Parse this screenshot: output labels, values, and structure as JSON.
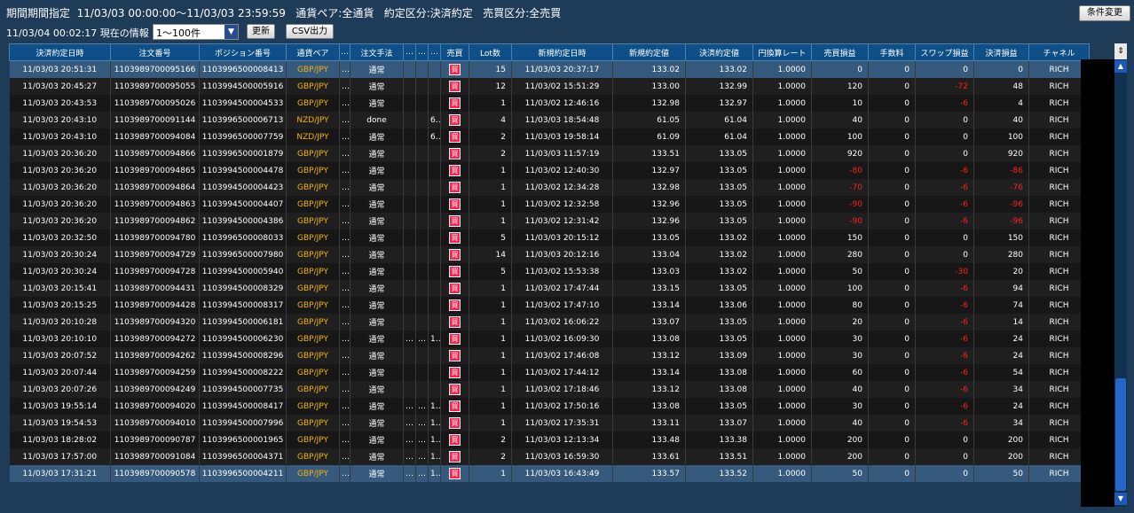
{
  "header": {
    "line1": "期間期間指定  11/03/03 00:00:00〜11/03/03 23:59:59   通貨ペア:全通貨   約定区分:決済約定   売買区分:全売買",
    "condition_button": "条件変更",
    "timestamp_info": "11/03/04 00:02:17 現在の情報",
    "range_select": "1〜100件",
    "refresh_button": "更新",
    "csv_button": "CSV出力"
  },
  "columns": [
    "決済約定日時",
    "注文番号",
    "ポジション番号",
    "通貨ペア",
    "…",
    "注文手法",
    "…",
    "…",
    "…",
    "売買",
    "Lot数",
    "新規約定日時",
    "新規約定値",
    "決済約定値",
    "円換算レート",
    "売買損益",
    "手数料",
    "スワップ損益",
    "決済損益",
    "チャネル"
  ],
  "colors": {
    "header_bg": "#0d4f86",
    "gold_pair": "#f4b400",
    "negative": "#ff2020",
    "buy_badge": "#ff1f4b"
  },
  "rows": [
    {
      "settle": "11/03/03 20:51:31",
      "order": "1103989700095166",
      "pos": "1103996500008413",
      "pair": "GBP/JPY",
      "e1": "…",
      "method": "通常",
      "e2": "",
      "e3": "",
      "e4": "",
      "side": "買",
      "lot": "15",
      "new_dt": "11/03/03 20:37:17",
      "new_px": "133.02",
      "set_px": "133.02",
      "rate": "1.0000",
      "pl": "0",
      "fee": "0",
      "swap": "0",
      "net": "0",
      "ch": "RICH",
      "sel": true
    },
    {
      "settle": "11/03/03 20:45:27",
      "order": "1103989700095055",
      "pos": "1103994500005916",
      "pair": "GBP/JPY",
      "e1": "…",
      "method": "通常",
      "e2": "",
      "e3": "",
      "e4": "",
      "side": "買",
      "lot": "12",
      "new_dt": "11/03/02 15:51:29",
      "new_px": "133.00",
      "set_px": "132.99",
      "rate": "1.0000",
      "pl": "120",
      "fee": "0",
      "swap": "-72",
      "net": "48",
      "ch": "RICH"
    },
    {
      "settle": "11/03/03 20:43:53",
      "order": "1103989700095026",
      "pos": "1103994500004533",
      "pair": "GBP/JPY",
      "e1": "…",
      "method": "通常",
      "e2": "",
      "e3": "",
      "e4": "",
      "side": "買",
      "lot": "1",
      "new_dt": "11/03/02 12:46:16",
      "new_px": "132.98",
      "set_px": "132.97",
      "rate": "1.0000",
      "pl": "10",
      "fee": "0",
      "swap": "-6",
      "net": "4",
      "ch": "RICH"
    },
    {
      "settle": "11/03/03 20:43:10",
      "order": "1103989700091144",
      "pos": "1103996500006713",
      "pair": "NZD/JPY",
      "e1": "…",
      "method": "done",
      "e2": "",
      "e3": "",
      "e4": "6…",
      "side": "買",
      "lot": "4",
      "new_dt": "11/03/03 18:54:48",
      "new_px": "61.05",
      "set_px": "61.04",
      "rate": "1.0000",
      "pl": "40",
      "fee": "0",
      "swap": "0",
      "net": "40",
      "ch": "RICH"
    },
    {
      "settle": "11/03/03 20:43:10",
      "order": "1103989700094084",
      "pos": "1103996500007759",
      "pair": "NZD/JPY",
      "e1": "…",
      "method": "通常",
      "e2": "",
      "e3": "",
      "e4": "6…",
      "side": "買",
      "lot": "2",
      "new_dt": "11/03/03 19:58:14",
      "new_px": "61.09",
      "set_px": "61.04",
      "rate": "1.0000",
      "pl": "100",
      "fee": "0",
      "swap": "0",
      "net": "100",
      "ch": "RICH"
    },
    {
      "settle": "11/03/03 20:36:20",
      "order": "1103989700094866",
      "pos": "1103996500001879",
      "pair": "GBP/JPY",
      "e1": "…",
      "method": "通常",
      "e2": "",
      "e3": "",
      "e4": "",
      "side": "買",
      "lot": "2",
      "new_dt": "11/03/03 11:57:19",
      "new_px": "133.51",
      "set_px": "133.05",
      "rate": "1.0000",
      "pl": "920",
      "fee": "0",
      "swap": "0",
      "net": "920",
      "ch": "RICH"
    },
    {
      "settle": "11/03/03 20:36:20",
      "order": "1103989700094865",
      "pos": "1103994500004478",
      "pair": "GBP/JPY",
      "e1": "…",
      "method": "通常",
      "e2": "",
      "e3": "",
      "e4": "",
      "side": "買",
      "lot": "1",
      "new_dt": "11/03/02 12:40:30",
      "new_px": "132.97",
      "set_px": "133.05",
      "rate": "1.0000",
      "pl": "-80",
      "fee": "0",
      "swap": "-6",
      "net": "-86",
      "ch": "RICH"
    },
    {
      "settle": "11/03/03 20:36:20",
      "order": "1103989700094864",
      "pos": "1103994500004423",
      "pair": "GBP/JPY",
      "e1": "…",
      "method": "通常",
      "e2": "",
      "e3": "",
      "e4": "",
      "side": "買",
      "lot": "1",
      "new_dt": "11/03/02 12:34:28",
      "new_px": "132.98",
      "set_px": "133.05",
      "rate": "1.0000",
      "pl": "-70",
      "fee": "0",
      "swap": "-6",
      "net": "-76",
      "ch": "RICH"
    },
    {
      "settle": "11/03/03 20:36:20",
      "order": "1103989700094863",
      "pos": "1103994500004407",
      "pair": "GBP/JPY",
      "e1": "…",
      "method": "通常",
      "e2": "",
      "e3": "",
      "e4": "",
      "side": "買",
      "lot": "1",
      "new_dt": "11/03/02 12:32:58",
      "new_px": "132.96",
      "set_px": "133.05",
      "rate": "1.0000",
      "pl": "-90",
      "fee": "0",
      "swap": "-6",
      "net": "-96",
      "ch": "RICH"
    },
    {
      "settle": "11/03/03 20:36:20",
      "order": "1103989700094862",
      "pos": "1103994500004386",
      "pair": "GBP/JPY",
      "e1": "…",
      "method": "通常",
      "e2": "",
      "e3": "",
      "e4": "",
      "side": "買",
      "lot": "1",
      "new_dt": "11/03/02 12:31:42",
      "new_px": "132.96",
      "set_px": "133.05",
      "rate": "1.0000",
      "pl": "-90",
      "fee": "0",
      "swap": "-6",
      "net": "-96",
      "ch": "RICH"
    },
    {
      "settle": "11/03/03 20:32:50",
      "order": "1103989700094780",
      "pos": "1103996500008033",
      "pair": "GBP/JPY",
      "e1": "…",
      "method": "通常",
      "e2": "",
      "e3": "",
      "e4": "",
      "side": "買",
      "lot": "5",
      "new_dt": "11/03/03 20:15:12",
      "new_px": "133.05",
      "set_px": "133.02",
      "rate": "1.0000",
      "pl": "150",
      "fee": "0",
      "swap": "0",
      "net": "150",
      "ch": "RICH"
    },
    {
      "settle": "11/03/03 20:30:24",
      "order": "1103989700094729",
      "pos": "1103996500007980",
      "pair": "GBP/JPY",
      "e1": "…",
      "method": "通常",
      "e2": "",
      "e3": "",
      "e4": "",
      "side": "買",
      "lot": "14",
      "new_dt": "11/03/03 20:12:16",
      "new_px": "133.04",
      "set_px": "133.02",
      "rate": "1.0000",
      "pl": "280",
      "fee": "0",
      "swap": "0",
      "net": "280",
      "ch": "RICH"
    },
    {
      "settle": "11/03/03 20:30:24",
      "order": "1103989700094728",
      "pos": "1103994500005940",
      "pair": "GBP/JPY",
      "e1": "…",
      "method": "通常",
      "e2": "",
      "e3": "",
      "e4": "",
      "side": "買",
      "lot": "5",
      "new_dt": "11/03/02 15:53:38",
      "new_px": "133.03",
      "set_px": "133.02",
      "rate": "1.0000",
      "pl": "50",
      "fee": "0",
      "swap": "-30",
      "net": "20",
      "ch": "RICH"
    },
    {
      "settle": "11/03/03 20:15:41",
      "order": "1103989700094431",
      "pos": "1103994500008329",
      "pair": "GBP/JPY",
      "e1": "…",
      "method": "通常",
      "e2": "",
      "e3": "",
      "e4": "",
      "side": "買",
      "lot": "1",
      "new_dt": "11/03/02 17:47:44",
      "new_px": "133.15",
      "set_px": "133.05",
      "rate": "1.0000",
      "pl": "100",
      "fee": "0",
      "swap": "-6",
      "net": "94",
      "ch": "RICH"
    },
    {
      "settle": "11/03/03 20:15:25",
      "order": "1103989700094428",
      "pos": "1103994500008317",
      "pair": "GBP/JPY",
      "e1": "…",
      "method": "通常",
      "e2": "",
      "e3": "",
      "e4": "",
      "side": "買",
      "lot": "1",
      "new_dt": "11/03/02 17:47:10",
      "new_px": "133.14",
      "set_px": "133.06",
      "rate": "1.0000",
      "pl": "80",
      "fee": "0",
      "swap": "-6",
      "net": "74",
      "ch": "RICH"
    },
    {
      "settle": "11/03/03 20:10:28",
      "order": "1103989700094320",
      "pos": "1103994500006181",
      "pair": "GBP/JPY",
      "e1": "…",
      "method": "通常",
      "e2": "",
      "e3": "",
      "e4": "",
      "side": "買",
      "lot": "1",
      "new_dt": "11/03/02 16:06:22",
      "new_px": "133.07",
      "set_px": "133.05",
      "rate": "1.0000",
      "pl": "20",
      "fee": "0",
      "swap": "-6",
      "net": "14",
      "ch": "RICH"
    },
    {
      "settle": "11/03/03 20:10:10",
      "order": "1103989700094272",
      "pos": "1103994500006230",
      "pair": "GBP/JPY",
      "e1": "…",
      "method": "通常",
      "e2": "…",
      "e3": "…",
      "e4": "1…",
      "side": "買",
      "lot": "1",
      "new_dt": "11/03/02 16:09:30",
      "new_px": "133.08",
      "set_px": "133.05",
      "rate": "1.0000",
      "pl": "30",
      "fee": "0",
      "swap": "-6",
      "net": "24",
      "ch": "RICH"
    },
    {
      "settle": "11/03/03 20:07:52",
      "order": "1103989700094262",
      "pos": "1103994500008296",
      "pair": "GBP/JPY",
      "e1": "…",
      "method": "通常",
      "e2": "",
      "e3": "",
      "e4": "",
      "side": "買",
      "lot": "1",
      "new_dt": "11/03/02 17:46:08",
      "new_px": "133.12",
      "set_px": "133.09",
      "rate": "1.0000",
      "pl": "30",
      "fee": "0",
      "swap": "-6",
      "net": "24",
      "ch": "RICH"
    },
    {
      "settle": "11/03/03 20:07:44",
      "order": "1103989700094259",
      "pos": "1103994500008222",
      "pair": "GBP/JPY",
      "e1": "…",
      "method": "通常",
      "e2": "",
      "e3": "",
      "e4": "",
      "side": "買",
      "lot": "1",
      "new_dt": "11/03/02 17:44:12",
      "new_px": "133.14",
      "set_px": "133.08",
      "rate": "1.0000",
      "pl": "60",
      "fee": "0",
      "swap": "-6",
      "net": "54",
      "ch": "RICH"
    },
    {
      "settle": "11/03/03 20:07:26",
      "order": "1103989700094249",
      "pos": "1103994500007735",
      "pair": "GBP/JPY",
      "e1": "…",
      "method": "通常",
      "e2": "",
      "e3": "",
      "e4": "",
      "side": "買",
      "lot": "1",
      "new_dt": "11/03/02 17:18:46",
      "new_px": "133.12",
      "set_px": "133.08",
      "rate": "1.0000",
      "pl": "40",
      "fee": "0",
      "swap": "-6",
      "net": "34",
      "ch": "RICH"
    },
    {
      "settle": "11/03/03 19:55:14",
      "order": "1103989700094020",
      "pos": "1103994500008417",
      "pair": "GBP/JPY",
      "e1": "…",
      "method": "通常",
      "e2": "…",
      "e3": "…",
      "e4": "1…",
      "side": "買",
      "lot": "1",
      "new_dt": "11/03/02 17:50:16",
      "new_px": "133.08",
      "set_px": "133.05",
      "rate": "1.0000",
      "pl": "30",
      "fee": "0",
      "swap": "-6",
      "net": "24",
      "ch": "RICH"
    },
    {
      "settle": "11/03/03 19:54:53",
      "order": "1103989700094010",
      "pos": "1103994500007996",
      "pair": "GBP/JPY",
      "e1": "…",
      "method": "通常",
      "e2": "…",
      "e3": "…",
      "e4": "1…",
      "side": "買",
      "lot": "1",
      "new_dt": "11/03/02 17:35:31",
      "new_px": "133.11",
      "set_px": "133.07",
      "rate": "1.0000",
      "pl": "40",
      "fee": "0",
      "swap": "-6",
      "net": "34",
      "ch": "RICH"
    },
    {
      "settle": "11/03/03 18:28:02",
      "order": "1103989700090787",
      "pos": "1103996500001965",
      "pair": "GBP/JPY",
      "e1": "…",
      "method": "通常",
      "e2": "…",
      "e3": "…",
      "e4": "1…",
      "side": "買",
      "lot": "2",
      "new_dt": "11/03/03 12:13:34",
      "new_px": "133.48",
      "set_px": "133.38",
      "rate": "1.0000",
      "pl": "200",
      "fee": "0",
      "swap": "0",
      "net": "200",
      "ch": "RICH"
    },
    {
      "settle": "11/03/03 17:57:00",
      "order": "1103989700091084",
      "pos": "1103996500004371",
      "pair": "GBP/JPY",
      "e1": "…",
      "method": "通常",
      "e2": "…",
      "e3": "…",
      "e4": "1…",
      "side": "買",
      "lot": "2",
      "new_dt": "11/03/03 16:59:30",
      "new_px": "133.61",
      "set_px": "133.51",
      "rate": "1.0000",
      "pl": "200",
      "fee": "0",
      "swap": "0",
      "net": "200",
      "ch": "RICH"
    },
    {
      "settle": "11/03/03 17:31:21",
      "order": "1103989700090578",
      "pos": "1103996500004211",
      "pair": "GBP/JPY",
      "e1": "…",
      "method": "通常",
      "e2": "…",
      "e3": "…",
      "e4": "1…",
      "side": "買",
      "lot": "1",
      "new_dt": "11/03/03 16:43:49",
      "new_px": "133.57",
      "set_px": "133.52",
      "rate": "1.0000",
      "pl": "50",
      "fee": "0",
      "swap": "0",
      "net": "50",
      "ch": "RICH",
      "sel": true
    }
  ]
}
